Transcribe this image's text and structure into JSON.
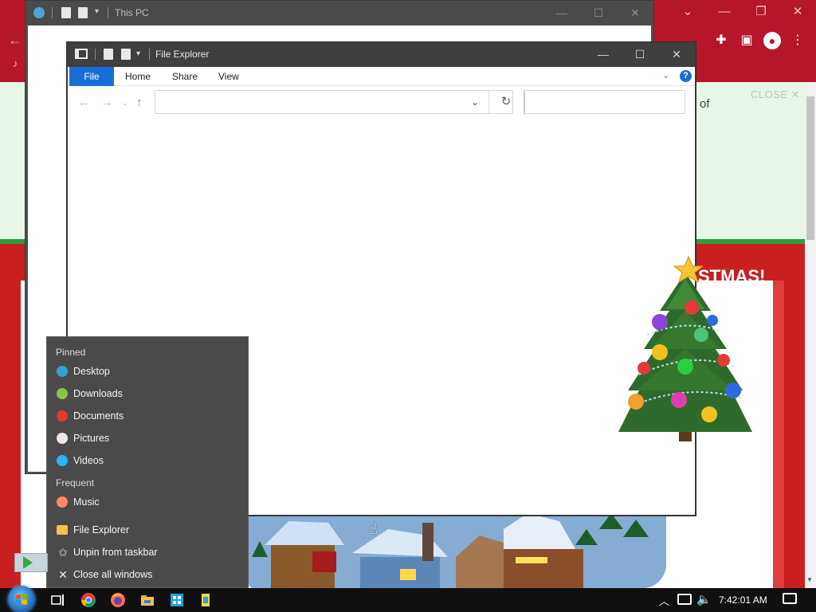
{
  "background_page": {
    "text_of": "of",
    "close_label": "CLOSE ✕",
    "banner_partial": "STMAS!"
  },
  "this_pc_window": {
    "title": "This PC"
  },
  "file_explorer": {
    "title": "File Explorer",
    "ribbon_tabs": [
      "File",
      "Home",
      "Share",
      "View"
    ],
    "help_label": "?",
    "address_value": "",
    "search_placeholder": ""
  },
  "jump_list": {
    "pinned_header": "Pinned",
    "pinned": [
      {
        "label": "Desktop",
        "icon": "desktop-icon",
        "color": "#2ea3d6"
      },
      {
        "label": "Downloads",
        "icon": "downloads-icon",
        "color": "#8bc34a"
      },
      {
        "label": "Documents",
        "icon": "documents-icon",
        "color": "#e53935"
      },
      {
        "label": "Pictures",
        "icon": "pictures-icon",
        "color": "#f0e6e6"
      },
      {
        "label": "Videos",
        "icon": "videos-icon",
        "color": "#29b6f6"
      }
    ],
    "frequent_header": "Frequent",
    "frequent": [
      {
        "label": "Music",
        "icon": "music-icon",
        "color": "#ff8a65"
      }
    ],
    "actions": [
      {
        "label": "File Explorer",
        "icon": "folder-icon"
      },
      {
        "label": "Unpin from taskbar",
        "icon": "unpin-icon"
      },
      {
        "label": "Close all windows",
        "icon": "close-icon"
      }
    ]
  },
  "taskbar": {
    "apps": [
      "chrome-icon",
      "firefox-icon",
      "file-explorer-icon",
      "app-icon-blue",
      "app-icon-yellow"
    ],
    "clock": "7:42:01 AM"
  },
  "colors": {
    "accent": "#1a6ed8",
    "page_red": "#c81f1f",
    "chrome_red": "#b5162a"
  }
}
